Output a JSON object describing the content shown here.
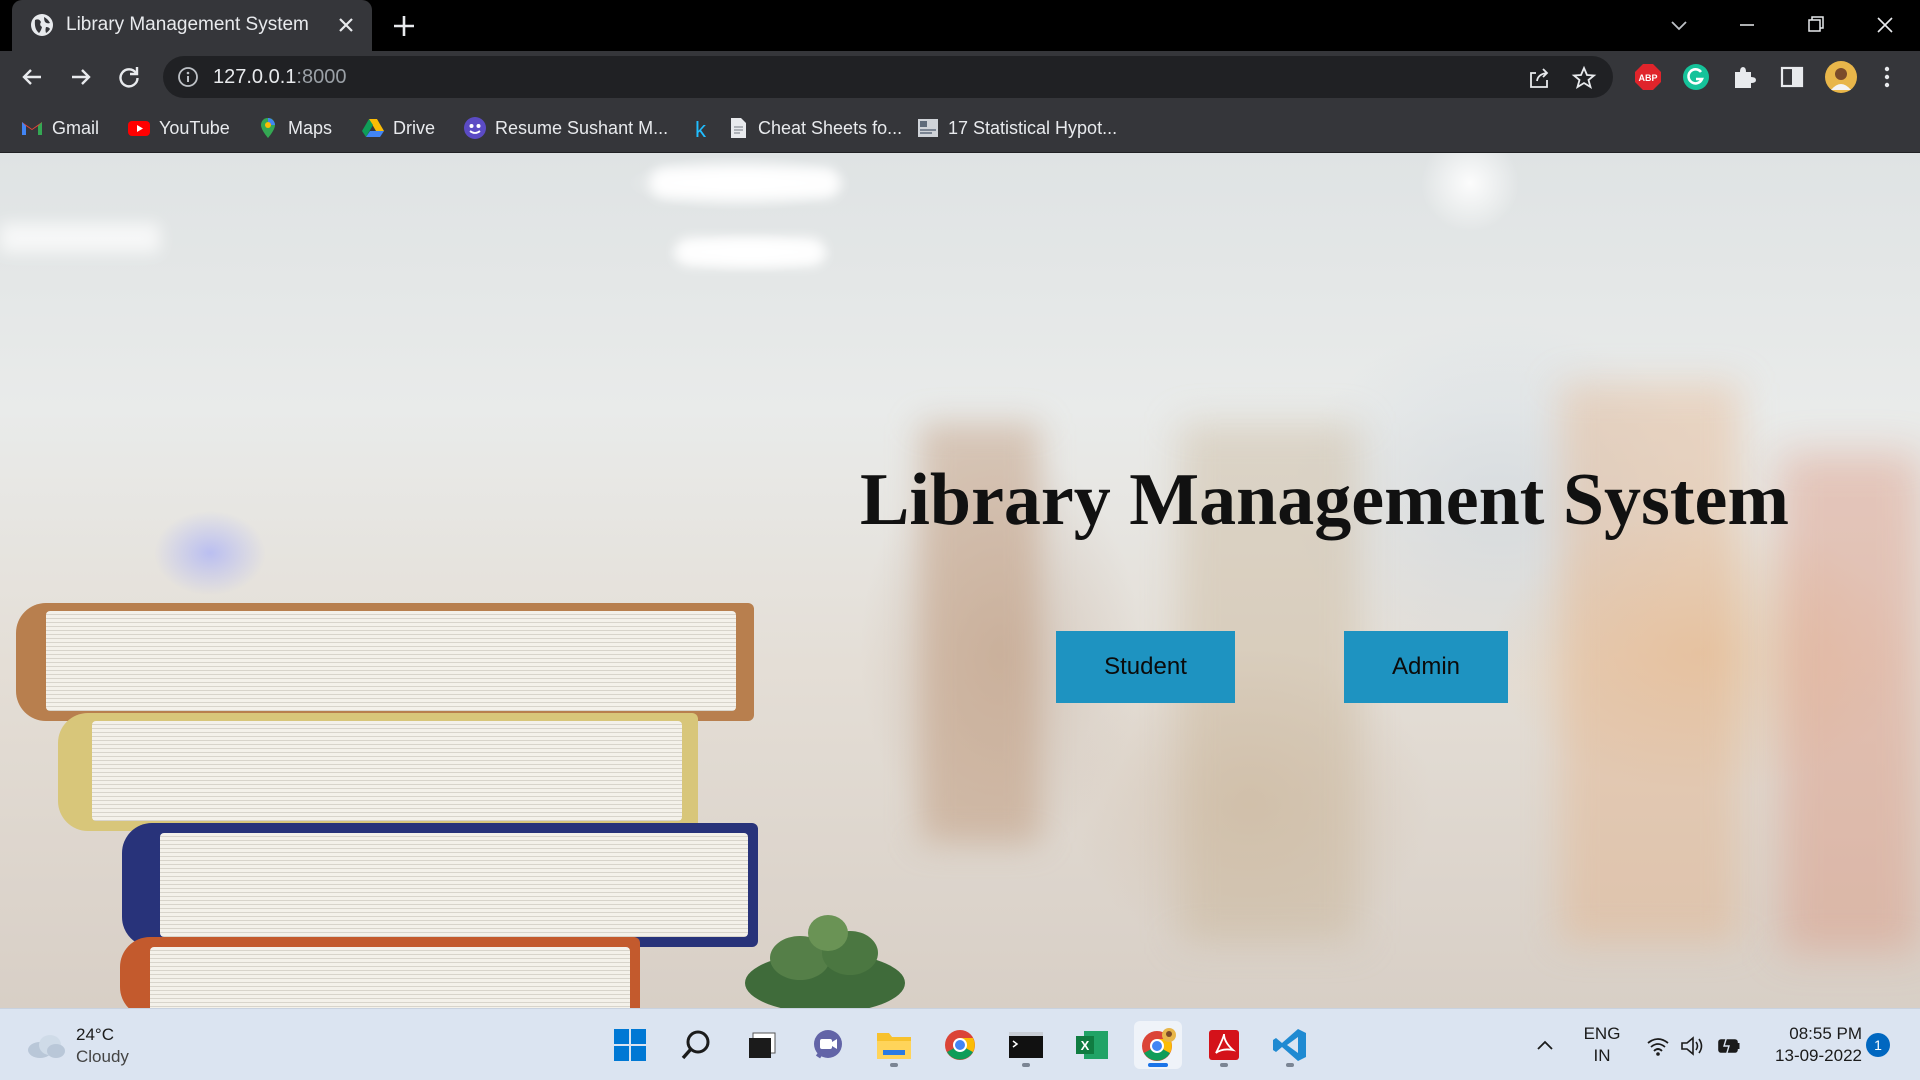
{
  "browser": {
    "tab_title": "Library Management System",
    "url_host": "127.0.0.1",
    "url_port": ":8000",
    "extensions": [
      "abp-icon",
      "grammarly-icon",
      "puzzle-icon",
      "side-panel-icon",
      "profile-avatar",
      "kebab-menu-icon"
    ]
  },
  "bookmarks": [
    {
      "label": "Gmail",
      "icon": "gmail-icon"
    },
    {
      "label": "YouTube",
      "icon": "youtube-icon"
    },
    {
      "label": "Maps",
      "icon": "maps-icon"
    },
    {
      "label": "Drive",
      "icon": "drive-icon"
    },
    {
      "label": "Resume Sushant M...",
      "icon": "resume-icon"
    },
    {
      "label": "",
      "icon": "k-icon"
    },
    {
      "label": "Cheat Sheets fo...",
      "icon": "document-icon"
    },
    {
      "label": "17 Statistical Hypot...",
      "icon": "image-icon"
    }
  ],
  "page": {
    "heading": "Library Management System",
    "student_button": "Student",
    "admin_button": "Admin",
    "accent_color": "#1e93c1"
  },
  "taskbar": {
    "weather_temp": "24°C",
    "weather_condition": "Cloudy",
    "language_top": "ENG",
    "language_bottom": "IN",
    "time": "08:55 PM",
    "date": "13-09-2022",
    "notification_count": "1"
  }
}
